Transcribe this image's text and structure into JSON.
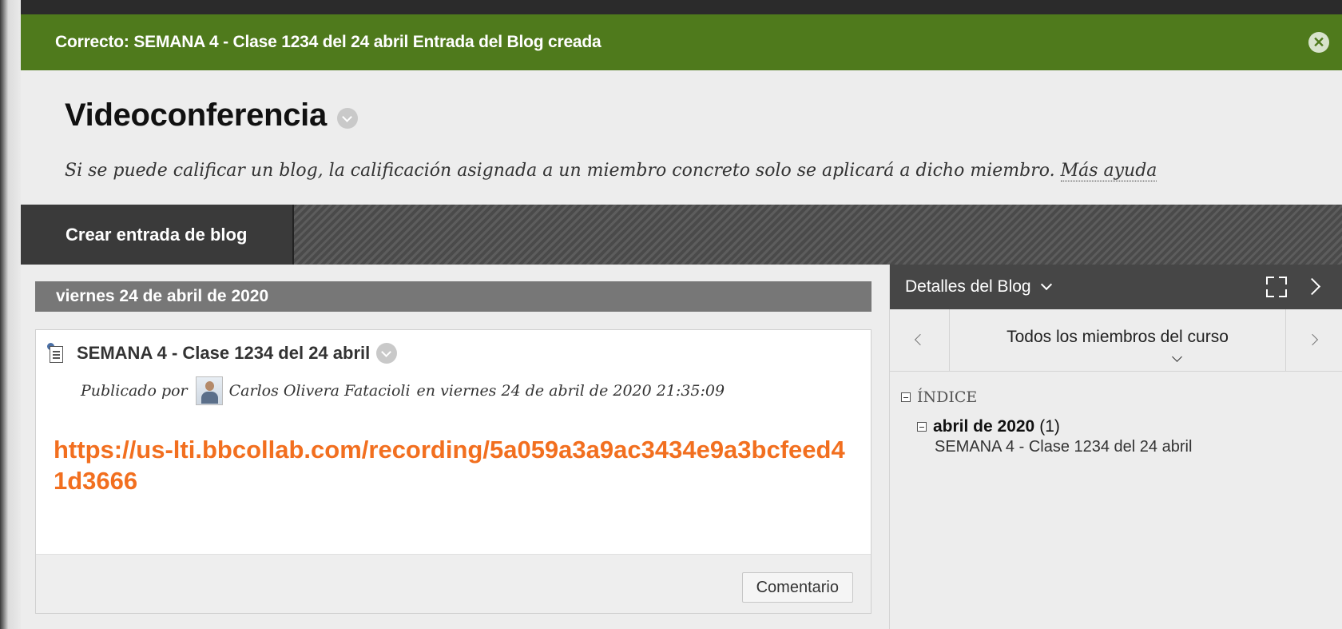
{
  "banner": {
    "message": "Correcto: SEMANA 4 - Clase 1234 del 24 abril Entrada del Blog creada"
  },
  "header": {
    "title": "Videoconferencia",
    "instructions": "Si se puede calificar un blog, la calificación asignada a un miembro concreto solo se aplicará a dicho miembro.",
    "more_help": "Más ayuda"
  },
  "action_bar": {
    "create_entry_label": "Crear entrada de blog"
  },
  "main": {
    "date_header": "viernes 24 de abril de 2020",
    "entry": {
      "title": "SEMANA 4 - Clase 1234 del 24 abril",
      "posted_by_label": "Publicado por",
      "author": "Carlos Olivera Fatacioli",
      "posted_on": "en viernes 24 de abril de 2020 21:35:09",
      "link": "https://us-lti.bbcollab.com/recording/5a059a3a9ac3434e9a3bcfeed41d3666",
      "comment_button": "Comentario"
    }
  },
  "sidebar": {
    "title": "Detalles del Blog",
    "member_filter": "Todos los miembros del curso",
    "index_heading": "ÍNDICE",
    "month_label": "abril de 2020",
    "month_count": "(1)",
    "entries": [
      "SEMANA 4 - Clase 1234 del 24 abril"
    ]
  },
  "colors": {
    "banner_green": "#4f7a1c",
    "link_orange": "#f26f1f",
    "action_bar_dark": "#3a3a3a",
    "sidebar_header": "#464646"
  },
  "icons": {
    "banner_close": "close-icon",
    "entry_type": "blog-entry-icon",
    "expand": "expand-icon",
    "collapse": "chevron-right-icon"
  }
}
